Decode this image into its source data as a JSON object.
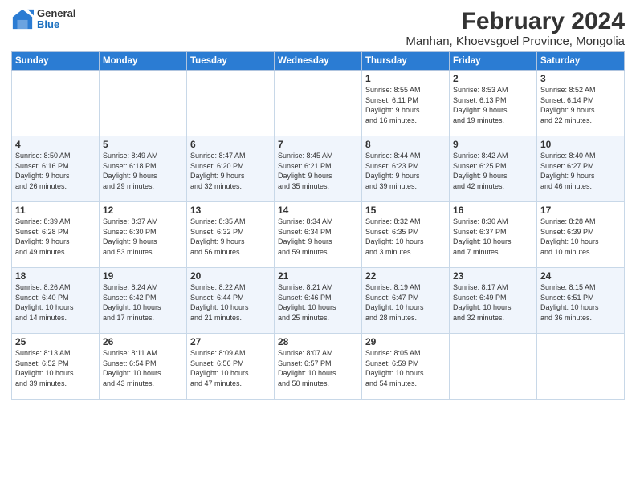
{
  "logo": {
    "general": "General",
    "blue": "Blue"
  },
  "title": "February 2024",
  "subtitle": "Manhan, Khoevsgoel Province, Mongolia",
  "days_of_week": [
    "Sunday",
    "Monday",
    "Tuesday",
    "Wednesday",
    "Thursday",
    "Friday",
    "Saturday"
  ],
  "weeks": [
    [
      {
        "day": "",
        "info": ""
      },
      {
        "day": "",
        "info": ""
      },
      {
        "day": "",
        "info": ""
      },
      {
        "day": "",
        "info": ""
      },
      {
        "day": "1",
        "info": "Sunrise: 8:55 AM\nSunset: 6:11 PM\nDaylight: 9 hours\nand 16 minutes."
      },
      {
        "day": "2",
        "info": "Sunrise: 8:53 AM\nSunset: 6:13 PM\nDaylight: 9 hours\nand 19 minutes."
      },
      {
        "day": "3",
        "info": "Sunrise: 8:52 AM\nSunset: 6:14 PM\nDaylight: 9 hours\nand 22 minutes."
      }
    ],
    [
      {
        "day": "4",
        "info": "Sunrise: 8:50 AM\nSunset: 6:16 PM\nDaylight: 9 hours\nand 26 minutes."
      },
      {
        "day": "5",
        "info": "Sunrise: 8:49 AM\nSunset: 6:18 PM\nDaylight: 9 hours\nand 29 minutes."
      },
      {
        "day": "6",
        "info": "Sunrise: 8:47 AM\nSunset: 6:20 PM\nDaylight: 9 hours\nand 32 minutes."
      },
      {
        "day": "7",
        "info": "Sunrise: 8:45 AM\nSunset: 6:21 PM\nDaylight: 9 hours\nand 35 minutes."
      },
      {
        "day": "8",
        "info": "Sunrise: 8:44 AM\nSunset: 6:23 PM\nDaylight: 9 hours\nand 39 minutes."
      },
      {
        "day": "9",
        "info": "Sunrise: 8:42 AM\nSunset: 6:25 PM\nDaylight: 9 hours\nand 42 minutes."
      },
      {
        "day": "10",
        "info": "Sunrise: 8:40 AM\nSunset: 6:27 PM\nDaylight: 9 hours\nand 46 minutes."
      }
    ],
    [
      {
        "day": "11",
        "info": "Sunrise: 8:39 AM\nSunset: 6:28 PM\nDaylight: 9 hours\nand 49 minutes."
      },
      {
        "day": "12",
        "info": "Sunrise: 8:37 AM\nSunset: 6:30 PM\nDaylight: 9 hours\nand 53 minutes."
      },
      {
        "day": "13",
        "info": "Sunrise: 8:35 AM\nSunset: 6:32 PM\nDaylight: 9 hours\nand 56 minutes."
      },
      {
        "day": "14",
        "info": "Sunrise: 8:34 AM\nSunset: 6:34 PM\nDaylight: 9 hours\nand 59 minutes."
      },
      {
        "day": "15",
        "info": "Sunrise: 8:32 AM\nSunset: 6:35 PM\nDaylight: 10 hours\nand 3 minutes."
      },
      {
        "day": "16",
        "info": "Sunrise: 8:30 AM\nSunset: 6:37 PM\nDaylight: 10 hours\nand 7 minutes."
      },
      {
        "day": "17",
        "info": "Sunrise: 8:28 AM\nSunset: 6:39 PM\nDaylight: 10 hours\nand 10 minutes."
      }
    ],
    [
      {
        "day": "18",
        "info": "Sunrise: 8:26 AM\nSunset: 6:40 PM\nDaylight: 10 hours\nand 14 minutes."
      },
      {
        "day": "19",
        "info": "Sunrise: 8:24 AM\nSunset: 6:42 PM\nDaylight: 10 hours\nand 17 minutes."
      },
      {
        "day": "20",
        "info": "Sunrise: 8:22 AM\nSunset: 6:44 PM\nDaylight: 10 hours\nand 21 minutes."
      },
      {
        "day": "21",
        "info": "Sunrise: 8:21 AM\nSunset: 6:46 PM\nDaylight: 10 hours\nand 25 minutes."
      },
      {
        "day": "22",
        "info": "Sunrise: 8:19 AM\nSunset: 6:47 PM\nDaylight: 10 hours\nand 28 minutes."
      },
      {
        "day": "23",
        "info": "Sunrise: 8:17 AM\nSunset: 6:49 PM\nDaylight: 10 hours\nand 32 minutes."
      },
      {
        "day": "24",
        "info": "Sunrise: 8:15 AM\nSunset: 6:51 PM\nDaylight: 10 hours\nand 36 minutes."
      }
    ],
    [
      {
        "day": "25",
        "info": "Sunrise: 8:13 AM\nSunset: 6:52 PM\nDaylight: 10 hours\nand 39 minutes."
      },
      {
        "day": "26",
        "info": "Sunrise: 8:11 AM\nSunset: 6:54 PM\nDaylight: 10 hours\nand 43 minutes."
      },
      {
        "day": "27",
        "info": "Sunrise: 8:09 AM\nSunset: 6:56 PM\nDaylight: 10 hours\nand 47 minutes."
      },
      {
        "day": "28",
        "info": "Sunrise: 8:07 AM\nSunset: 6:57 PM\nDaylight: 10 hours\nand 50 minutes."
      },
      {
        "day": "29",
        "info": "Sunrise: 8:05 AM\nSunset: 6:59 PM\nDaylight: 10 hours\nand 54 minutes."
      },
      {
        "day": "",
        "info": ""
      },
      {
        "day": "",
        "info": ""
      }
    ]
  ]
}
